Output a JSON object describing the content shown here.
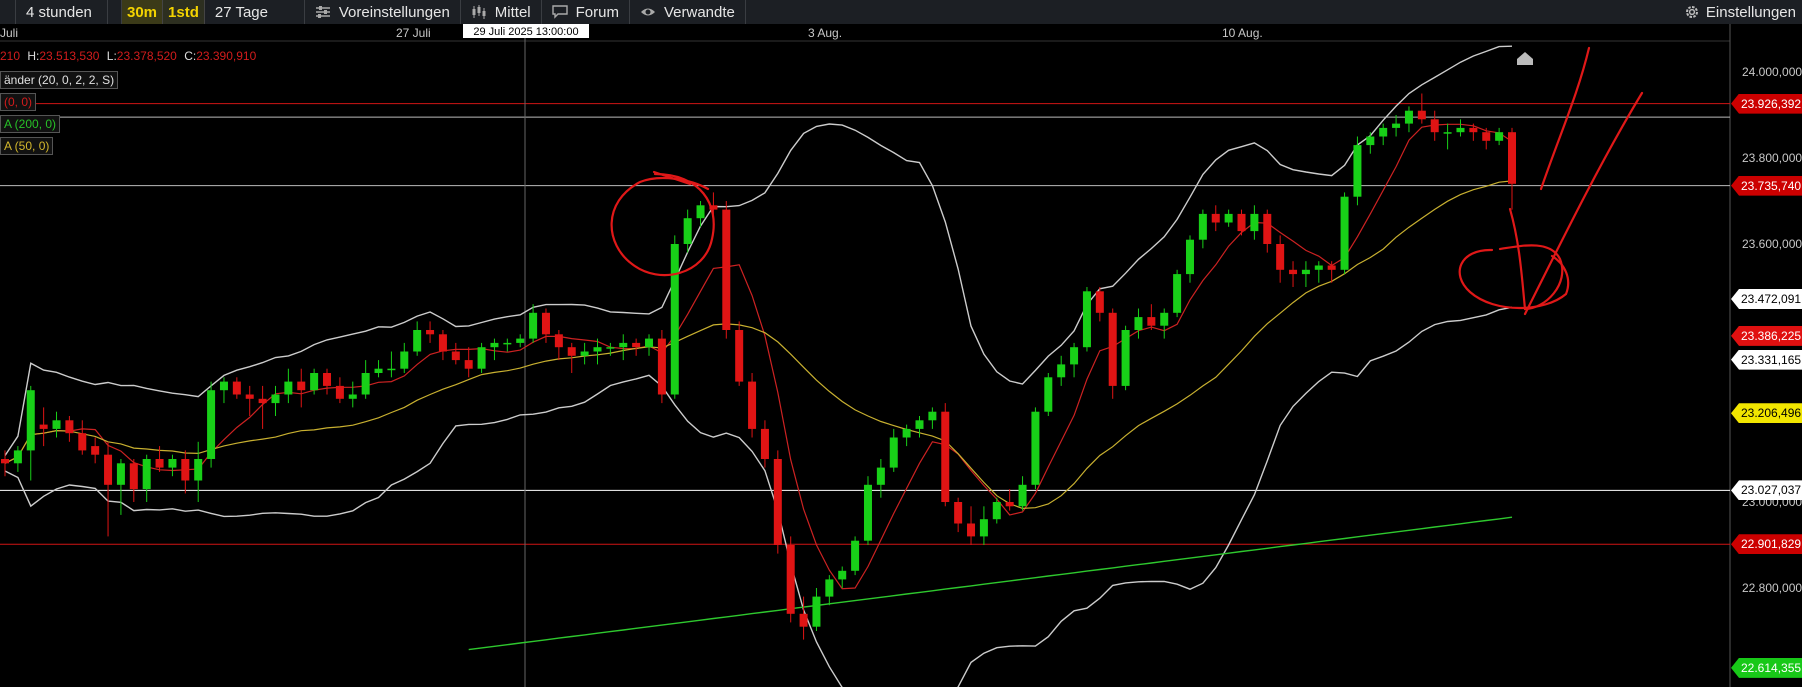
{
  "toolbar": {
    "range_label": "4 stunden",
    "interval_30m": "30m",
    "interval_1std": "1std",
    "period_label": "27 Tage",
    "presets_label": "Voreinstellungen",
    "average_label": "Mittel",
    "forum_label": "Forum",
    "related_label": "Verwandte",
    "settings_label": "Einstellungen",
    "icons": {
      "presets": "sliders-icon",
      "average": "candlestick-icon",
      "forum": "speech-bubble-icon",
      "related": "eye-icon",
      "settings": "gear-icon"
    }
  },
  "ohlc": {
    "o_value": "210",
    "h_label": "H:",
    "h_value": "23.513,530",
    "l_label": "L:",
    "l_value": "23.378,520",
    "c_label": "C:",
    "c_value": "23.390,910"
  },
  "indicators": {
    "bands": "änder (20, 0, 2, 2, S)",
    "red_line": "(0, 0)",
    "green_line": "A (200, 0)",
    "yellow_line": "A (50, 0)"
  },
  "crosshair_label": "29 Juli 2025 13:00:00",
  "price_boxes": [
    {
      "text": "23.926,392",
      "bg": "#cc0000",
      "fg": "#ffffff",
      "value": 23926.392
    },
    {
      "text": "23.735,740",
      "bg": "#cc0000",
      "fg": "#ffffff",
      "value": 23735.74
    },
    {
      "text": "23.472,091",
      "bg": "#ffffff",
      "fg": "#000000",
      "value": 23472.091
    },
    {
      "text": "23.386,225",
      "bg": "#e01010",
      "fg": "#ffffff",
      "value": 23386.225
    },
    {
      "text": "23.331,165",
      "bg": "#ffffff",
      "fg": "#000000",
      "value": 23331.165
    },
    {
      "text": "23.206,496",
      "bg": "#f2e600",
      "fg": "#000000",
      "value": 23206.496
    },
    {
      "text": "23.027,037",
      "bg": "#ffffff",
      "fg": "#000000",
      "value": 23027.037
    },
    {
      "text": "22.901,829",
      "bg": "#cc0000",
      "fg": "#ffffff",
      "value": 22901.829
    },
    {
      "text": "22.614,355",
      "bg": "#18c818",
      "fg": "#ffffff",
      "value": 22614.355
    }
  ],
  "chart_data": {
    "type": "candlestick",
    "x_ticks": [
      "Juli",
      "27 Juli",
      "3 Aug.",
      "10 Aug."
    ],
    "y_ticks": [
      "24.000,000",
      "23.800,000",
      "23.600,000",
      "23.000,000",
      "22.800,000"
    ],
    "ylim": [
      22600,
      24110
    ],
    "horizontal_lines": [
      {
        "value": 23926.392,
        "color": "#d01414"
      },
      {
        "value": 23895,
        "color": "#bbbbbb"
      },
      {
        "value": 23735.74,
        "color": "#bbbbbb"
      },
      {
        "value": 23027.037,
        "color": "#ffffff"
      },
      {
        "value": 22901.829,
        "color": "#d01414"
      }
    ],
    "candles": [
      [
        23100,
        23120,
        23060,
        23090
      ],
      [
        23090,
        23130,
        23070,
        23120
      ],
      [
        23120,
        23270,
        23050,
        23260
      ],
      [
        23180,
        23220,
        23130,
        23170
      ],
      [
        23170,
        23210,
        23150,
        23190
      ],
      [
        23190,
        23200,
        23140,
        23160
      ],
      [
        23160,
        23190,
        23110,
        23120
      ],
      [
        23130,
        23150,
        23090,
        23110
      ],
      [
        23110,
        23140,
        22920,
        23040
      ],
      [
        23040,
        23100,
        22970,
        23090
      ],
      [
        23090,
        23100,
        23000,
        23030
      ],
      [
        23030,
        23110,
        23000,
        23100
      ],
      [
        23100,
        23130,
        23070,
        23080
      ],
      [
        23080,
        23110,
        23060,
        23100
      ],
      [
        23100,
        23120,
        23020,
        23050
      ],
      [
        23050,
        23140,
        23000,
        23100
      ],
      [
        23100,
        23280,
        23080,
        23260
      ],
      [
        23260,
        23290,
        23230,
        23280
      ],
      [
        23280,
        23290,
        23240,
        23250
      ],
      [
        23250,
        23270,
        23200,
        23240
      ],
      [
        23240,
        23270,
        23170,
        23230
      ],
      [
        23230,
        23270,
        23200,
        23250
      ],
      [
        23250,
        23310,
        23230,
        23280
      ],
      [
        23280,
        23310,
        23220,
        23260
      ],
      [
        23260,
        23310,
        23250,
        23300
      ],
      [
        23300,
        23310,
        23250,
        23270
      ],
      [
        23270,
        23290,
        23230,
        23240
      ],
      [
        23240,
        23280,
        23220,
        23250
      ],
      [
        23250,
        23330,
        23240,
        23300
      ],
      [
        23300,
        23330,
        23290,
        23310
      ],
      [
        23310,
        23350,
        23290,
        23310
      ],
      [
        23310,
        23370,
        23300,
        23350
      ],
      [
        23350,
        23420,
        23340,
        23400
      ],
      [
        23400,
        23420,
        23370,
        23390
      ],
      [
        23390,
        23400,
        23330,
        23350
      ],
      [
        23350,
        23370,
        23320,
        23330
      ],
      [
        23330,
        23360,
        23290,
        23310
      ],
      [
        23310,
        23370,
        23300,
        23360
      ],
      [
        23360,
        23380,
        23330,
        23370
      ],
      [
        23370,
        23380,
        23350,
        23370
      ],
      [
        23370,
        23390,
        23360,
        23380
      ],
      [
        23380,
        23460,
        23370,
        23440
      ],
      [
        23440,
        23450,
        23370,
        23390
      ],
      [
        23390,
        23400,
        23330,
        23360
      ],
      [
        23360,
        23370,
        23300,
        23340
      ],
      [
        23340,
        23370,
        23320,
        23350
      ],
      [
        23350,
        23380,
        23320,
        23360
      ],
      [
        23360,
        23370,
        23340,
        23360
      ],
      [
        23360,
        23390,
        23330,
        23370
      ],
      [
        23370,
        23380,
        23340,
        23360
      ],
      [
        23360,
        23390,
        23340,
        23380
      ],
      [
        23380,
        23400,
        23230,
        23250
      ],
      [
        23250,
        23620,
        23240,
        23600
      ],
      [
        23600,
        23680,
        23580,
        23660
      ],
      [
        23660,
        23700,
        23640,
        23690
      ],
      [
        23690,
        23720,
        23660,
        23680
      ],
      [
        23680,
        23700,
        23380,
        23400
      ],
      [
        23400,
        23420,
        23270,
        23280
      ],
      [
        23280,
        23300,
        23150,
        23170
      ],
      [
        23170,
        23190,
        23080,
        23100
      ],
      [
        23100,
        23120,
        22880,
        22900
      ],
      [
        22900,
        22920,
        22720,
        22740
      ],
      [
        22740,
        22780,
        22680,
        22710
      ],
      [
        22710,
        22800,
        22700,
        22780
      ],
      [
        22780,
        22830,
        22760,
        22820
      ],
      [
        22820,
        22850,
        22800,
        22840
      ],
      [
        22840,
        22920,
        22830,
        22910
      ],
      [
        22910,
        23060,
        22900,
        23040
      ],
      [
        23040,
        23100,
        23010,
        23080
      ],
      [
        23080,
        23170,
        23070,
        23150
      ],
      [
        23150,
        23180,
        23130,
        23170
      ],
      [
        23170,
        23200,
        23150,
        23190
      ],
      [
        23190,
        23220,
        23170,
        23210
      ],
      [
        23210,
        23230,
        22990,
        23000
      ],
      [
        23000,
        23010,
        22930,
        22950
      ],
      [
        22950,
        22990,
        22900,
        22920
      ],
      [
        22920,
        22990,
        22900,
        22960
      ],
      [
        22960,
        23010,
        22950,
        23000
      ],
      [
        23000,
        23030,
        22980,
        22990
      ],
      [
        22990,
        23060,
        22980,
        23040
      ],
      [
        23040,
        23220,
        23030,
        23210
      ],
      [
        23210,
        23300,
        23200,
        23290
      ],
      [
        23290,
        23340,
        23270,
        23320
      ],
      [
        23320,
        23370,
        23290,
        23360
      ],
      [
        23360,
        23500,
        23350,
        23490
      ],
      [
        23490,
        23500,
        23420,
        23440
      ],
      [
        23440,
        23450,
        23240,
        23270
      ],
      [
        23270,
        23410,
        23260,
        23400
      ],
      [
        23400,
        23450,
        23380,
        23430
      ],
      [
        23430,
        23460,
        23400,
        23410
      ],
      [
        23410,
        23450,
        23380,
        23440
      ],
      [
        23440,
        23540,
        23430,
        23530
      ],
      [
        23530,
        23620,
        23510,
        23610
      ],
      [
        23610,
        23680,
        23590,
        23670
      ],
      [
        23670,
        23690,
        23630,
        23650
      ],
      [
        23650,
        23680,
        23640,
        23670
      ],
      [
        23670,
        23680,
        23620,
        23630
      ],
      [
        23630,
        23690,
        23610,
        23670
      ],
      [
        23670,
        23680,
        23580,
        23600
      ],
      [
        23600,
        23620,
        23510,
        23540
      ],
      [
        23540,
        23560,
        23500,
        23530
      ],
      [
        23530,
        23560,
        23500,
        23540
      ],
      [
        23540,
        23560,
        23510,
        23550
      ],
      [
        23550,
        23560,
        23510,
        23540
      ],
      [
        23540,
        23720,
        23530,
        23710
      ],
      [
        23710,
        23850,
        23690,
        23830
      ],
      [
        23830,
        23860,
        23810,
        23850
      ],
      [
        23850,
        23880,
        23830,
        23870
      ],
      [
        23870,
        23900,
        23850,
        23880
      ],
      [
        23880,
        23920,
        23860,
        23910
      ],
      [
        23910,
        23950,
        23880,
        23890
      ],
      [
        23890,
        23910,
        23840,
        23860
      ],
      [
        23860,
        23880,
        23820,
        23860
      ],
      [
        23860,
        23890,
        23850,
        23870
      ],
      [
        23870,
        23880,
        23840,
        23860
      ],
      [
        23860,
        23870,
        23820,
        23840
      ],
      [
        23840,
        23870,
        23830,
        23860
      ],
      [
        23860,
        23870,
        23680,
        23740
      ]
    ],
    "series": [
      {
        "name": "",
        "color": "#cccccc",
        "role": "upper band"
      },
      {
        "name": "",
        "color": "#cccccc",
        "role": "lower band"
      },
      {
        "name": "",
        "color": "#cc2222",
        "role": "fast average"
      },
      {
        "name": "",
        "color": "#c8b030",
        "role": "50 average"
      },
      {
        "name": "",
        "color": "#2ec82e",
        "role": "200 average"
      }
    ]
  }
}
